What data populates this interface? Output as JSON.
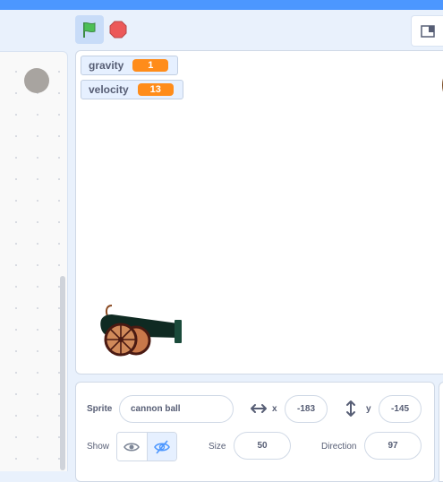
{
  "colors": {
    "accent": "#4c97ff",
    "variable_orange": "#ff8c1a",
    "stop_red": "#ec5959",
    "flag_green": "#4cbf56"
  },
  "stage_controls": {
    "green_flag_icon": "green-flag",
    "stop_icon": "stop-sign",
    "layout_icon": "small-stage-mode"
  },
  "monitors": [
    {
      "name": "gravity",
      "value": "1"
    },
    {
      "name": "velocity",
      "value": "13"
    }
  ],
  "sprite_info": {
    "sprite_label": "Sprite",
    "sprite_name": "cannon ball",
    "x_label": "x",
    "x_value": "-183",
    "y_label": "y",
    "y_value": "-145",
    "show_label": "Show",
    "size_label": "Size",
    "size_value": "50",
    "direction_label": "Direction",
    "direction_value": "97"
  }
}
